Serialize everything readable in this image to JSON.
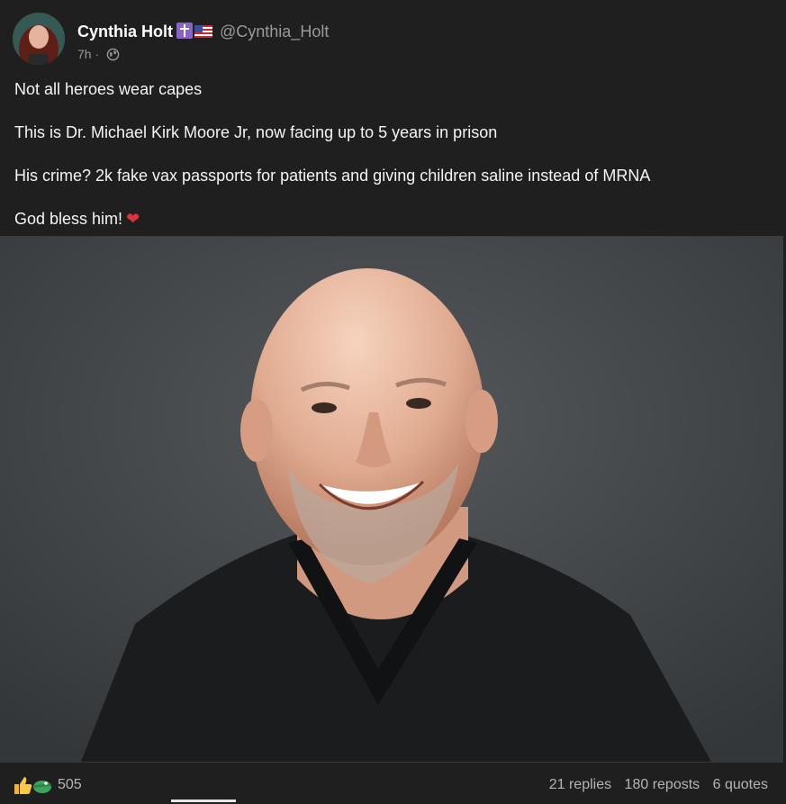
{
  "author": {
    "name": "Cynthia Holt",
    "handle": "@Cynthia_Holt",
    "badges": [
      "cross-badge-icon",
      "us-flag-icon"
    ],
    "time": "7h",
    "separator": "·",
    "visibility_icon": "globe-icon"
  },
  "post": {
    "lines": [
      "Not all heroes wear capes",
      "This is Dr. Michael Kirk Moore Jr, now facing up to 5 years in prison",
      "His crime? 2k fake vax passports for patients and giving children saline instead of MRNA",
      "God bless him!"
    ],
    "emoji": "❤"
  },
  "image": {
    "description_icon": "photo-of-smiling-bald-man-in-scrubs"
  },
  "footer": {
    "reaction_icons": [
      "thumbs-up-icon",
      "gator-icon"
    ],
    "reaction_count": "505",
    "replies": "21 replies",
    "reposts": "180 reposts",
    "quotes": "6 quotes"
  },
  "colors": {
    "background": "#1f1f20",
    "text": "#f4f4f4",
    "muted": "#9a9a9a",
    "heart": "#e0323b",
    "badge": "#8a63c9"
  }
}
